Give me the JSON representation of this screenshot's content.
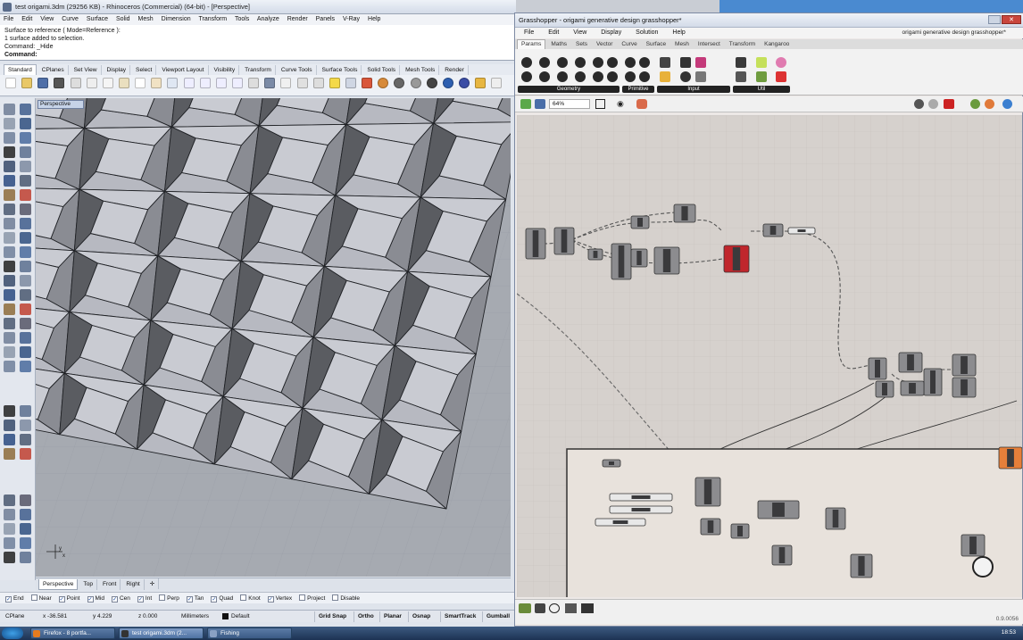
{
  "rhino": {
    "title": "test origami.3dm (29256 KB) - Rhinoceros (Commercial) (64-bit) - [Perspective]",
    "menu": [
      "File",
      "Edit",
      "View",
      "Curve",
      "Surface",
      "Solid",
      "Mesh",
      "Dimension",
      "Transform",
      "Tools",
      "Analyze",
      "Render",
      "Panels",
      "V-Ray",
      "Help"
    ],
    "command_history": [
      "Surface to reference ( Mode=Reference ):",
      "1 surface added to selection.",
      "Command: _Hide"
    ],
    "command_prompt": "Command:",
    "toolbar_tabs": [
      "Standard",
      "CPlanes",
      "Set View",
      "Display",
      "Select",
      "Viewport Layout",
      "Visibility",
      "Transform",
      "Curve Tools",
      "Surface Tools",
      "Solid Tools",
      "Mesh Tools",
      "Render"
    ],
    "viewport_name": "Perspective",
    "viewport_tabs": [
      "Perspective",
      "Top",
      "Front",
      "Right"
    ],
    "osnaps": [
      {
        "label": "End",
        "checked": true
      },
      {
        "label": "Near",
        "checked": false
      },
      {
        "label": "Point",
        "checked": true
      },
      {
        "label": "Mid",
        "checked": true
      },
      {
        "label": "Cen",
        "checked": true
      },
      {
        "label": "Int",
        "checked": true
      },
      {
        "label": "Perp",
        "checked": false
      },
      {
        "label": "Tan",
        "checked": true
      },
      {
        "label": "Quad",
        "checked": true
      },
      {
        "label": "Knot",
        "checked": false
      },
      {
        "label": "Vertex",
        "checked": true
      },
      {
        "label": "Project",
        "checked": false
      },
      {
        "label": "Disable",
        "checked": false
      }
    ],
    "status": {
      "cplane": "CPlane",
      "x": "x -36.581",
      "y": "y 4.229",
      "z": "z 0.000",
      "units": "Millimeters",
      "layer": "Default",
      "buttons": [
        "Grid Snap",
        "Ortho",
        "Planar",
        "Osnap",
        "SmartTrack",
        "Gumball"
      ]
    }
  },
  "grasshopper": {
    "title": "Grasshopper - origami generative design grasshopper*",
    "doc_title": "origami generative design grasshopper*",
    "menu": [
      "File",
      "Edit",
      "View",
      "Display",
      "Solution",
      "Help"
    ],
    "tabs": [
      "Params",
      "Maths",
      "Sets",
      "Vector",
      "Curve",
      "Surface",
      "Mesh",
      "Intersect",
      "Transform",
      "Kangaroo"
    ],
    "ribbon_groups": [
      "Geometry",
      "Primitive",
      "Input",
      "Util"
    ],
    "zoom": "64%",
    "version": "0.9.0056"
  },
  "taskbar": {
    "tasks": [
      "Firefox - 8 portfa...",
      "test origami.3dm (2...",
      "Fishing"
    ],
    "clock": "18:53"
  }
}
